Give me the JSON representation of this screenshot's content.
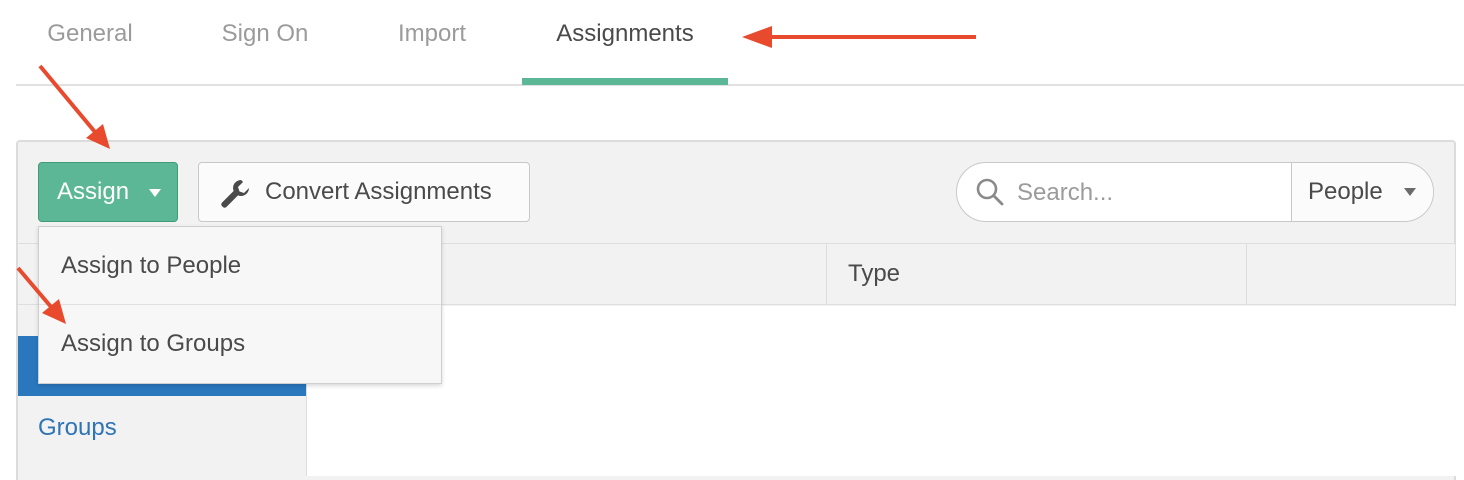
{
  "tabs": [
    {
      "label": "General",
      "active": false
    },
    {
      "label": "Sign On",
      "active": false
    },
    {
      "label": "Import",
      "active": false
    },
    {
      "label": "Assignments",
      "active": true
    }
  ],
  "toolbar": {
    "assign_label": "Assign",
    "convert_label": "Convert Assignments",
    "search_placeholder": "Search...",
    "filter_selected": "People"
  },
  "dropdown": {
    "items": [
      "Assign to People",
      "Assign to Groups"
    ]
  },
  "table": {
    "columns": [
      "",
      "Type",
      ""
    ]
  },
  "sidebar": {
    "items": [
      {
        "label": "",
        "active": true
      },
      {
        "label": "Groups",
        "active": false
      }
    ]
  },
  "colors": {
    "accent_green": "#5bb795",
    "link_blue": "#2f74b5",
    "sidebar_active": "#2a77bd",
    "annotation_red": "#e84a2e"
  },
  "icons": [
    "wrench-icon",
    "search-icon",
    "caret-down-icon",
    "annotation-arrow"
  ]
}
